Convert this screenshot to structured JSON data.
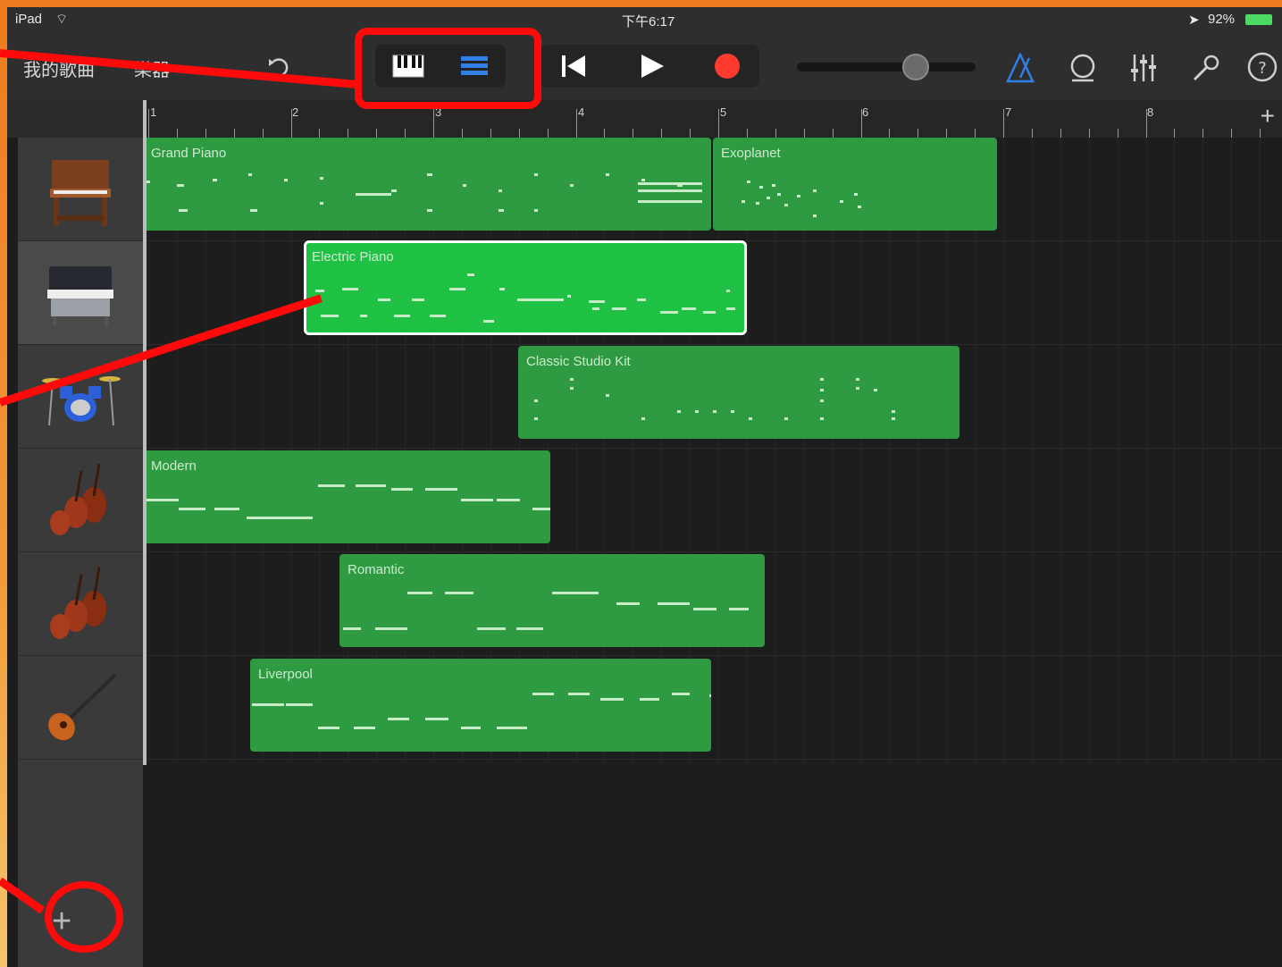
{
  "status_bar": {
    "device": "iPad",
    "time": "下午6:17",
    "battery": "92%"
  },
  "toolbar": {
    "my_songs": "我的歌曲",
    "instruments": "樂器",
    "icons": [
      "undo-icon",
      "keyboard-view-icon",
      "tracks-view-icon",
      "rewind-icon",
      "play-icon",
      "record-icon",
      "volume-slider",
      "metronome-icon",
      "loop-icon",
      "mixer-icon",
      "settings-wrench-icon",
      "help-icon"
    ],
    "accent_color": "#2f7fe6",
    "record_color": "#ff3b30"
  },
  "ruler": {
    "bars": [
      "1",
      "2",
      "3",
      "4",
      "5",
      "6",
      "7",
      "8"
    ],
    "add_label": "+"
  },
  "tracks": [
    {
      "instrument": "organ-icon",
      "regions": [
        {
          "label": "Grand Piano"
        },
        {
          "label": "Exoplanet"
        }
      ]
    },
    {
      "instrument": "electric-piano-icon",
      "regions": [
        {
          "label": "Electric Piano",
          "selected": true
        }
      ]
    },
    {
      "instrument": "drum-kit-icon",
      "regions": [
        {
          "label": "Classic Studio Kit"
        }
      ]
    },
    {
      "instrument": "strings-icon",
      "regions": [
        {
          "label": "Modern"
        }
      ]
    },
    {
      "instrument": "strings-icon",
      "regions": [
        {
          "label": "Romantic"
        }
      ]
    },
    {
      "instrument": "bass-guitar-icon",
      "regions": [
        {
          "label": "Liverpool"
        }
      ]
    }
  ],
  "add_track_label": "+",
  "annotation_color": "#ff0a0a"
}
